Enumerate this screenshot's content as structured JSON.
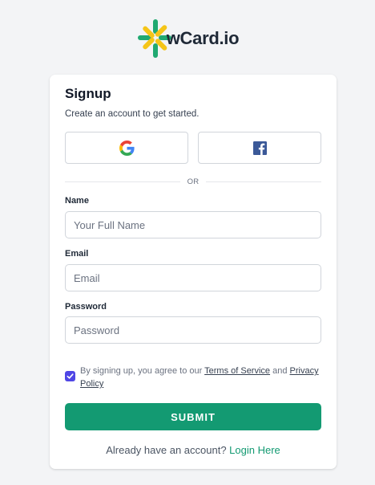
{
  "brand": {
    "name": "wCard.io",
    "icon": "wcard-logo-icon",
    "colors": {
      "green": "#1fa971",
      "yellow": "#f5c518",
      "teal": "#139a72"
    }
  },
  "signup": {
    "title": "Signup",
    "subtitle": "Create an account to get started.",
    "social": [
      {
        "provider": "Google",
        "icon": "google-icon"
      },
      {
        "provider": "Facebook",
        "icon": "facebook-icon"
      }
    ],
    "divider_text": "OR",
    "fields": {
      "name": {
        "label": "Name",
        "placeholder": "Your Full Name",
        "value": ""
      },
      "email": {
        "label": "Email",
        "placeholder": "Email",
        "value": ""
      },
      "password": {
        "label": "Password",
        "placeholder": "Password",
        "value": ""
      }
    },
    "terms": {
      "checked": true,
      "prefix": "By signing up, you agree to our",
      "terms_link": "Terms of Service",
      "conjunction": "and",
      "privacy_link": "Privacy Policy"
    },
    "submit_label": "SUBMIT",
    "login_prompt": "Already have an account?",
    "login_link": "Login Here"
  },
  "colors": {
    "background": "#f3f4f6",
    "primary": "#139a72",
    "checkbox": "#4f46e5"
  }
}
